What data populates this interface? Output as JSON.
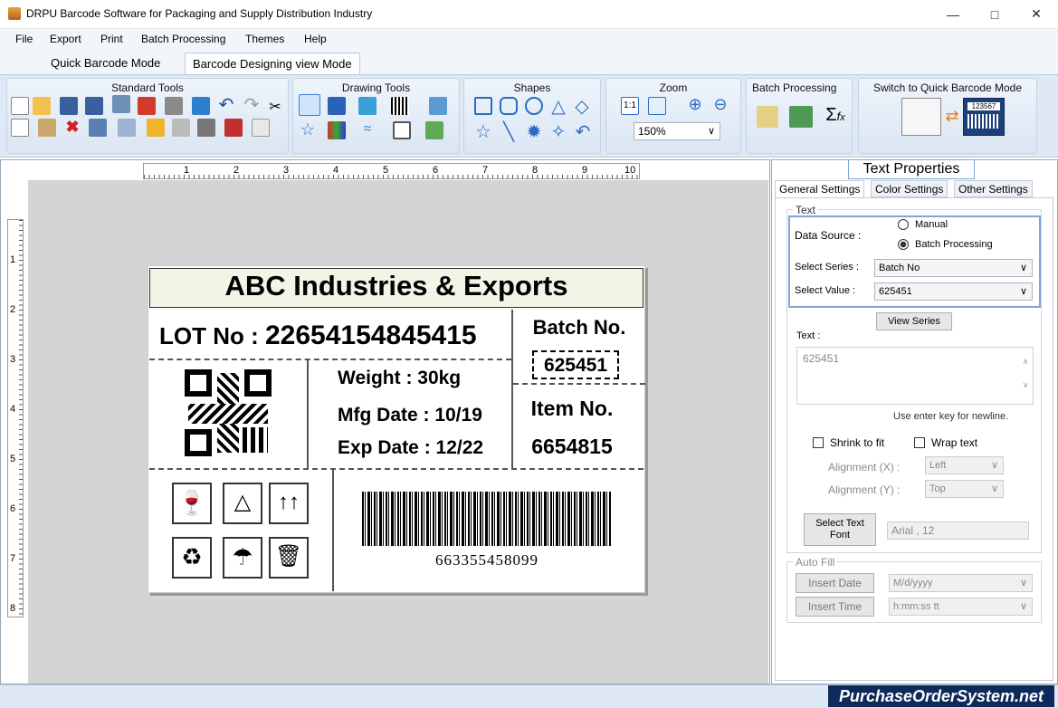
{
  "window": {
    "title": "DRPU Barcode Software for Packaging and Supply Distribution Industry"
  },
  "menu": [
    "File",
    "Export",
    "Print",
    "Batch Processing",
    "Themes",
    "Help"
  ],
  "mode_tabs": [
    "Quick Barcode Mode",
    "Barcode Designing view Mode"
  ],
  "ribbon": {
    "groups": [
      "Standard Tools",
      "Drawing Tools",
      "Shapes",
      "Zoom",
      "Batch Processing",
      "Switch to Quick Barcode Mode"
    ],
    "zoom_value": "150%",
    "switch_preview_number": "123567"
  },
  "ruler": {
    "horizontal": [
      "1",
      "2",
      "3",
      "4",
      "5",
      "6",
      "7",
      "8",
      "9",
      "10"
    ],
    "vertical": [
      "1",
      "2",
      "3",
      "4",
      "5",
      "6",
      "7",
      "8"
    ]
  },
  "label": {
    "header": "ABC Industries & Exports",
    "lot_label": "LOT No : ",
    "lot_value": "22654154845415",
    "batch_title": "Batch No.",
    "batch_value": "625451",
    "weight": "Weight : 30kg",
    "mfg": "Mfg Date : 10/19",
    "exp": "Exp Date : 12/22",
    "item_title": "Item No.",
    "item_value": "6654815",
    "barcode_number": "663355458099"
  },
  "panel": {
    "title": "Text Properties",
    "tabs": [
      "General Settings",
      "Color Settings",
      "Other Settings"
    ],
    "text_group": "Text",
    "data_source_label": "Data Source :",
    "radio_manual": "Manual",
    "radio_batch": "Batch Processing",
    "series_label": "Select Series :",
    "series_value": "Batch No",
    "value_label": "Select Value :",
    "value_value": "625451",
    "view_series": "View Series",
    "text_label": "Text :",
    "text_value": "625451",
    "newline_hint": "Use enter key for newline.",
    "shrink_label": "Shrink to fit",
    "wrap_label": "Wrap text",
    "align_x_label": "Alignment (X) :",
    "align_x_value": "Left",
    "align_y_label": "Alignment (Y) :",
    "align_y_value": "Top",
    "select_font_btn": "Select Text Font",
    "font_value": "Arial , 12",
    "autofill_group": "Auto Fill",
    "insert_date": "Insert Date",
    "date_format": "M/d/yyyy",
    "insert_time": "Insert Time",
    "time_format": "h:mm:ss tt"
  },
  "watermark": "PurchaseOrderSystem.net"
}
